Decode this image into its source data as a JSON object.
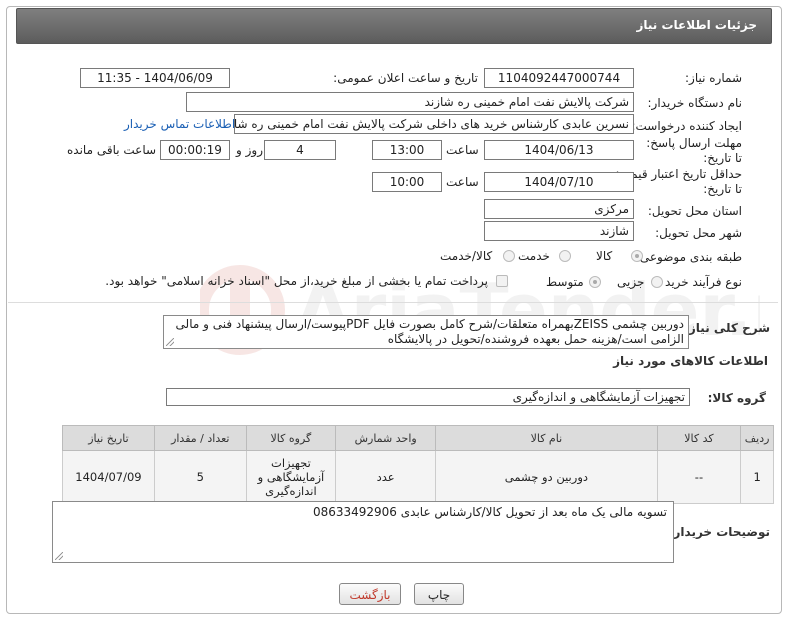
{
  "header": {
    "title": "جزئیات اطلاعات نیاز"
  },
  "fields": {
    "need_number_label": "شماره نیاز:",
    "need_number": "1104092447000744",
    "announce_label": "تاریخ و ساعت اعلان عمومی:",
    "announce_value": "1404/06/09 - 11:35",
    "buyer_org_label": "نام دستگاه خریدار:",
    "buyer_org": "شرکت پالایش نفت امام خمینی  ره  شازند",
    "creator_label": "ایجاد کننده درخواست:",
    "creator": "نسرین عابدی کارشناس خرید های داخلی  شرکت پالایش نفت امام خمینی  ره  شازند",
    "contact_link": "اطلاعات تماس خریدار",
    "reply_deadline_label": "مهلت ارسال پاسخ: تا تاریخ:",
    "reply_date": "1404/06/13",
    "time_label": "ساعت",
    "reply_time": "13:00",
    "days_value": "4",
    "days_label": "روز و",
    "remaining_time": "00:00:19",
    "remaining_label": "ساعت باقی مانده",
    "price_validity_label": "حداقل تاریخ اعتبار قیمت: تا تاریخ:",
    "price_date": "1404/07/10",
    "price_time_label": "ساعت",
    "price_time": "10:00",
    "province_label": "استان محل تحویل:",
    "province": "مرکزی",
    "city_label": "شهر محل تحویل:",
    "city": "شازند",
    "category_label": "طبقه بندی موضوعی:",
    "category_options": [
      "کالا",
      "خدمت",
      "کالا/خدمت"
    ],
    "process_label": "نوع فرآیند خرید :",
    "process_options": [
      "جزیی",
      "متوسط"
    ],
    "payment_note": "پرداخت تمام یا بخشی از مبلغ خرید،از محل \"اسناد خزانه اسلامی\" خواهد بود.",
    "summary_label": "شرح کلی نیاز:",
    "summary": "دوربین چشمی ZEISSبهمراه متعلقات/شرح کامل بصورت فایل PDFپیوست/ارسال پیشنهاد فنی و مالی الزامی است/هزینه حمل بعهده فروشنده/تحویل در پالایشگاه",
    "items_title": "اطلاعات کالاهای مورد نیاز",
    "group_label": "گروه کالا:",
    "group_value": "تجهیزات آزمایشگاهی و اندازه‌گیری"
  },
  "table": {
    "headers": [
      "ردیف",
      "کد کالا",
      "نام کالا",
      "واحد شمارش",
      "گروه کالا",
      "تعداد / مقدار",
      "تاریخ نیاز"
    ],
    "rows": [
      [
        "1",
        "--",
        "دوربین دو چشمی",
        "عدد",
        "تجهیزات آزمایشگاهی و اندازه‌گیری",
        "5",
        "1404/07/09"
      ]
    ]
  },
  "buyer_notes": {
    "label": "توضیحات خریدار:",
    "text": "تسویه مالی یک ماه بعد از تحویل کالا/کارشناس عابدی 08633492906"
  },
  "buttons": {
    "print": "چاپ",
    "back": "بازگشت"
  },
  "colors": {
    "header_bg": "#6b6b6b",
    "link": "#1a5fb4",
    "back_text": "#c0392b"
  }
}
